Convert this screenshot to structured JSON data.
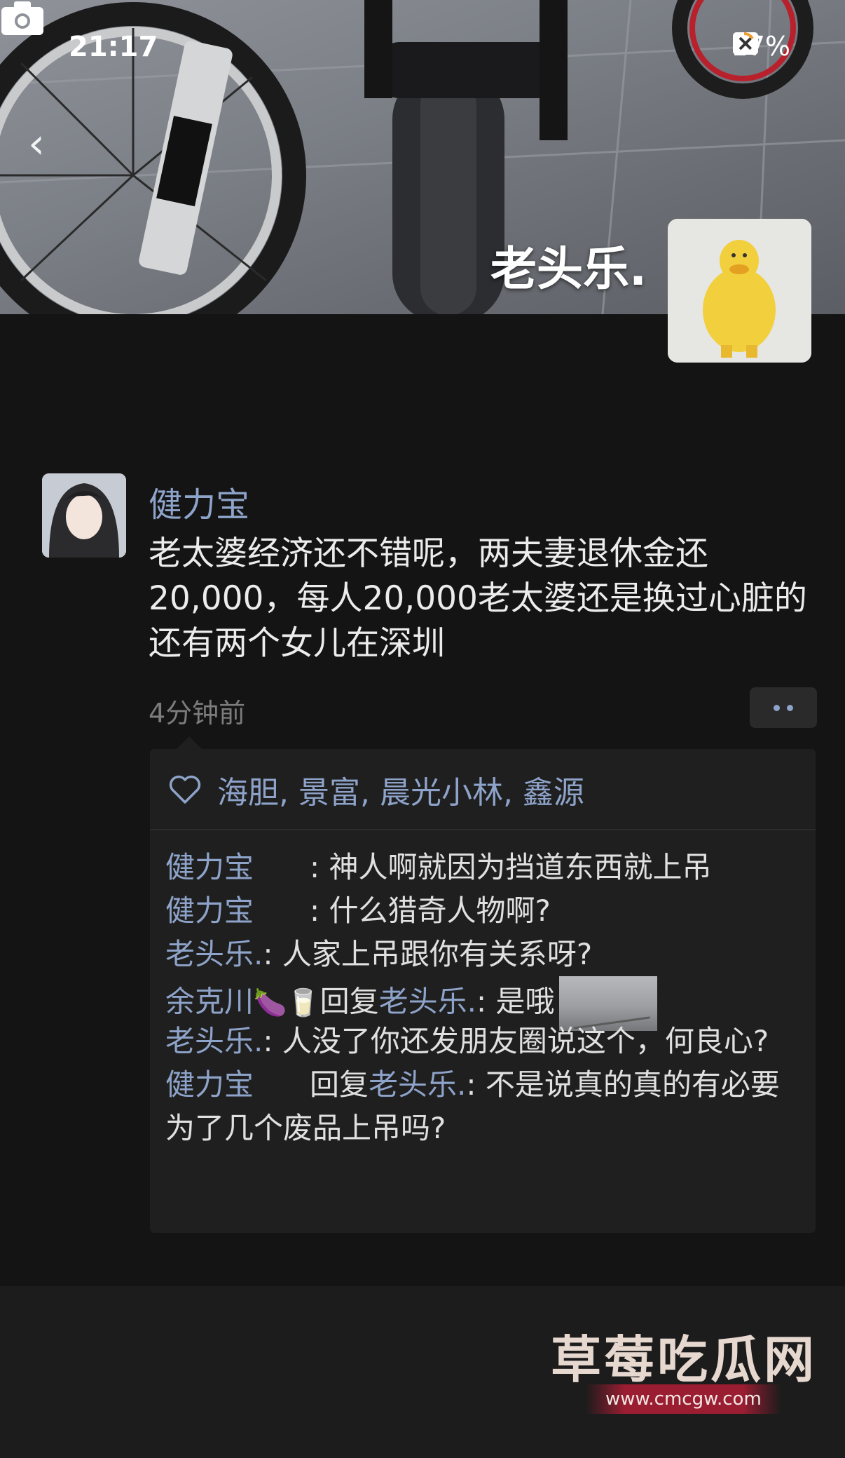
{
  "status_bar": {
    "time": "21:17",
    "battery": "17%",
    "icons": [
      "wifi-icon",
      "close-icon",
      "battery-icon"
    ]
  },
  "cover": {
    "name": "老头乐.",
    "icons": [
      "back-icon",
      "camera-icon"
    ]
  },
  "post": {
    "author": "健力宝",
    "text": "老太婆经济还不错呢，两夫妻退休金还20,000，每人20,000老太婆还是换过心脏的还有两个女儿在深圳",
    "time": "4分钟前",
    "likes": {
      "icon": "heart-icon",
      "names": "海胆, 景富, 晨光小林, 鑫源"
    },
    "comments": [
      {
        "name": "健力宝",
        "text": ": 神人啊就因为挡道东西就上吊"
      },
      {
        "name": "健力宝",
        "text": ": 什么猎奇人物啊?"
      },
      {
        "name": "老头乐.",
        "text": ": 人家上吊跟你有关系呀?"
      },
      {
        "name": "余克川",
        "emoji": "🍆🥛",
        "reply_word": "回复",
        "reply_to": "老头乐.",
        "text": ": 是哦"
      },
      {
        "name": "老头乐.",
        "text": ": 人没了你还发朋友圈说这个，何良心?"
      },
      {
        "name": "健力宝",
        "reply_word": "回复",
        "reply_to": "老头乐.",
        "text": ": 不是说真的真的有必要为了几个废品上吊吗?"
      }
    ]
  },
  "watermark": {
    "title": "草莓吃瓜网",
    "url": "www.cmcgw.com"
  },
  "colors": {
    "background": "#141414",
    "name_blue": "#8ea3c9",
    "panel": "#1f1f1f"
  }
}
